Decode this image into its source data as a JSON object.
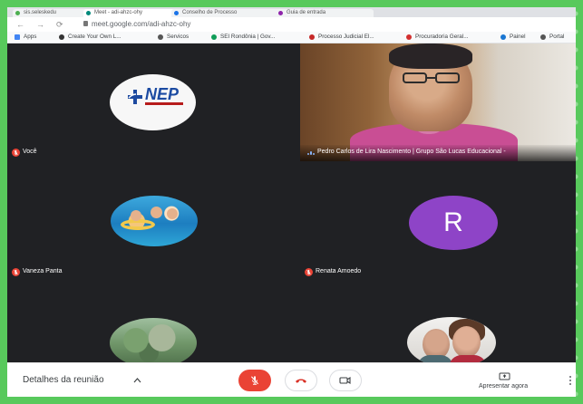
{
  "browser": {
    "url": "meet.google.com/adi-ahzc-ohy",
    "tabs": [
      {
        "label": "sis.seleskedu",
        "color": "#4caf50"
      },
      {
        "label": "Meet - adi-ahzc-ohy",
        "color": "#00897b"
      },
      {
        "label": "Conselho de Processo",
        "color": "#1a73e8"
      },
      {
        "label": "Guia de entrada",
        "color": "#8e24aa"
      }
    ],
    "bookmarks": [
      {
        "label": "Apps",
        "icon_color": "#4285f4"
      },
      {
        "label": "Create Your Own L...",
        "icon_color": "#333333"
      },
      {
        "label": "Servicos",
        "icon_color": "#555555"
      },
      {
        "label": "SEI Rondônia | Gov...",
        "icon_color": "#0f9d58"
      },
      {
        "label": "Processo Judicial El...",
        "icon_color": "#c62828"
      },
      {
        "label": "Procuradoria Geral...",
        "icon_color": "#d32f2f"
      },
      {
        "label": "Painel",
        "icon_color": "#1976d2"
      },
      {
        "label": "Portal",
        "icon_color": "#555555"
      }
    ]
  },
  "participants": {
    "tile1": {
      "name": "Você",
      "muted": true
    },
    "tile2": {
      "name": "Pedro Carlos de Lira Nascimento | Grupo São Lucas Educacional -",
      "speaking": true
    },
    "tile3": {
      "name": "Vaneza Panta",
      "muted": true
    },
    "tile4": {
      "name": "Renata Amoedo",
      "muted": true,
      "avatar_letter": "R",
      "avatar_color": "#8e44c7"
    },
    "tile5": {
      "name": ""
    },
    "tile6": {
      "name": ""
    }
  },
  "logo": {
    "text": "NEP"
  },
  "controls": {
    "details_label": "Detalhes da reunião",
    "present_label": "Apresentar agora"
  },
  "colors": {
    "meet_background": "#202124",
    "danger": "#ea4335",
    "accent": "#8ab4f8",
    "desktop_frame": "#58c95c"
  }
}
